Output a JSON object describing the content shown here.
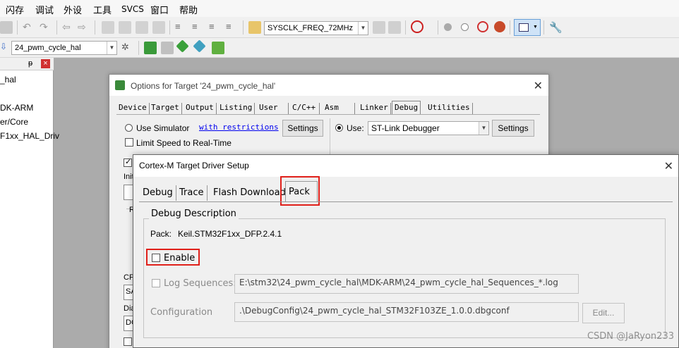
{
  "menubar": {
    "items": [
      "闪存",
      "调试",
      "外设",
      "工具",
      "SVCS",
      "窗口",
      "帮助"
    ]
  },
  "toolbar1": {
    "define_combo": "SYSCLK_FREQ_72MHz"
  },
  "toolbar2": {
    "target_combo": "24_pwm_cycle_hal"
  },
  "project_panel": {
    "pin_glyph": "ᵽ",
    "close_glyph": "×",
    "items": [
      "_hal",
      "DK-ARM",
      "er/Core",
      "F1xx_HAL_Driv"
    ]
  },
  "options_dialog": {
    "title": "Options for Target '24_pwm_cycle_hal'",
    "close_glyph": "✕",
    "tabs": [
      "Device",
      "Target",
      "Output",
      "Listing",
      "User",
      "C/C++",
      "Asm",
      "Linker",
      "Debug",
      "Utilities"
    ],
    "active_tab": "Debug",
    "use_simulator_label": "Use Simulator",
    "with_restrictions_link": "with restrictions",
    "settings_label": "Settings",
    "limit_speed_label": "Limit Speed to Real-Time",
    "use_label": "Use:",
    "debugger_value": "ST-Link Debugger",
    "settings_right_label": "Settings",
    "left_partial": {
      "init": "Init",
      "r": "R",
      "cp": "CP",
      "sa": "SA",
      "dia": "Dia",
      "dc": "DC"
    }
  },
  "cortex_dialog": {
    "title": "Cortex-M Target Driver Setup",
    "close_glyph": "✕",
    "tabs": [
      "Debug",
      "Trace",
      "Flash Download",
      "Pack"
    ],
    "active_tab": "Pack",
    "group_title": "Debug Description",
    "pack_label": "Pack:",
    "pack_value": "Keil.STM32F1xx_DFP.2.4.1",
    "enable_label": "Enable",
    "enable_checked": false,
    "log_sequences_label": "Log Sequences:",
    "log_sequences_value": "E:\\stm32\\24_pwm_cycle_hal\\MDK-ARM\\24_pwm_cycle_hal_Sequences_*.log",
    "configuration_label": "Configuration",
    "configuration_value": ".\\DebugConfig\\24_pwm_cycle_hal_STM32F103ZE_1.0.0.dbgconf",
    "edit_button": "Edit..."
  },
  "watermark": "CSDN @JaRyon233",
  "colors": {
    "highlight_red": "#e0201a",
    "link_blue": "#0000ee"
  }
}
